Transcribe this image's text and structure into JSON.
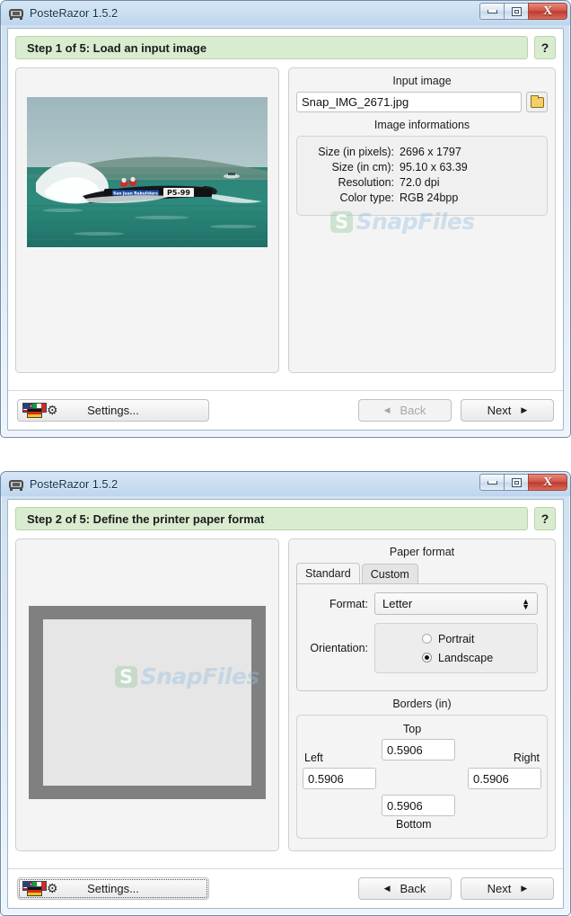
{
  "app": {
    "title": "PosteRazor 1.5.2",
    "icon": "posterazor-icon"
  },
  "window_controls": {
    "minimize": "minimize-icon",
    "maximize": "maximize-icon",
    "close": "X"
  },
  "watermark": {
    "badge": "S",
    "text": "SnapFiles"
  },
  "window1": {
    "step_header": "Step 1 of 5: Load an input image",
    "help_label": "?",
    "input_image": {
      "section_title": "Input image",
      "value": "Snap_IMG_2671.jpg",
      "placeholder": "",
      "browse_icon": "folder-icon"
    },
    "image_information": {
      "section_title": "Image informations",
      "rows": [
        {
          "label": "Size (in pixels):",
          "value": "2696 x 1797"
        },
        {
          "label": "Size (in cm):",
          "value": "95.10 x 63.39"
        },
        {
          "label": "Resolution:",
          "value": "72.0 dpi"
        },
        {
          "label": "Color type:",
          "value": "RGB 24bpp"
        }
      ]
    },
    "footer": {
      "settings": "Settings...",
      "back": "Back",
      "next": "Next",
      "back_enabled": false
    }
  },
  "window2": {
    "step_header": "Step 2 of 5: Define the printer paper format",
    "help_label": "?",
    "paper_format": {
      "section_title": "Paper format",
      "tabs": [
        {
          "label": "Standard",
          "active": true
        },
        {
          "label": "Custom",
          "active": false
        }
      ],
      "format_label": "Format:",
      "format_value": "Letter",
      "orientation_label": "Orientation:",
      "orientation_options": [
        {
          "label": "Portrait",
          "selected": false
        },
        {
          "label": "Landscape",
          "selected": true
        }
      ]
    },
    "borders": {
      "section_title": "Borders (in)",
      "top_label": "Top",
      "top_value": "0.5906",
      "left_label": "Left",
      "left_value": "0.5906",
      "right_label": "Right",
      "right_value": "0.5906",
      "bottom_label": "Bottom",
      "bottom_value": "0.5906"
    },
    "footer": {
      "settings": "Settings...",
      "back": "Back",
      "next": "Next",
      "back_enabled": true
    }
  },
  "colors": {
    "step_header_bg": "#d9ecd0",
    "titlebar": "#cbdff2",
    "close_button": "#bb3b2e",
    "paper_border_gray": "#808080"
  }
}
